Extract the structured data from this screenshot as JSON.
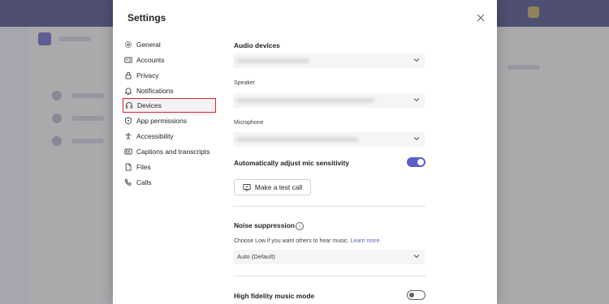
{
  "settings": {
    "title": "Settings",
    "nav": [
      {
        "label": "General",
        "icon": "gear-icon"
      },
      {
        "label": "Accounts",
        "icon": "id-card-icon"
      },
      {
        "label": "Privacy",
        "icon": "lock-icon"
      },
      {
        "label": "Notifications",
        "icon": "bell-icon"
      },
      {
        "label": "Devices",
        "icon": "headset-icon",
        "selected": true
      },
      {
        "label": "App permissions",
        "icon": "shield-icon"
      },
      {
        "label": "Accessibility",
        "icon": "accessibility-icon"
      },
      {
        "label": "Captions and transcripts",
        "icon": "captions-icon"
      },
      {
        "label": "Files",
        "icon": "file-icon"
      },
      {
        "label": "Calls",
        "icon": "phone-icon"
      }
    ]
  },
  "devices": {
    "audio_devices_title": "Audio devices",
    "speaker_label": "Speaker",
    "microphone_label": "Microphone",
    "auto_adjust_label": "Automatically adjust mic sensitivity",
    "auto_adjust_enabled": true,
    "test_call_label": "Make a test call",
    "noise_title": "Noise suppression",
    "noise_help_text": "Choose Low if you want others to hear music.",
    "noise_help_link": "Learn more.",
    "noise_value": "Auto (Default)",
    "hifi_label": "High fidelity music mode",
    "hifi_enabled": false
  },
  "colors": {
    "accent": "#5b5fc7",
    "highlight_box": "#d9232e",
    "teams_header": "#5b5d86"
  }
}
